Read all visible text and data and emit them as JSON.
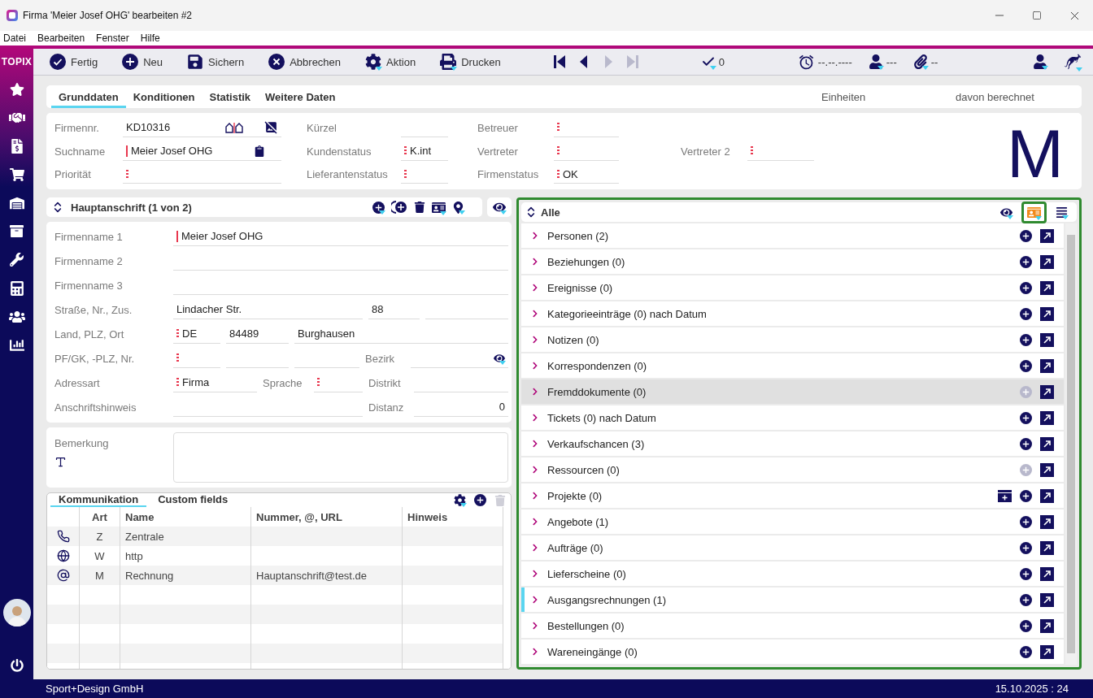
{
  "window": {
    "title": "Firma 'Meier Josef OHG' bearbeiten #2"
  },
  "menu": [
    "Datei",
    "Bearbeiten",
    "Fenster",
    "Hilfe"
  ],
  "sidebar": {
    "logo": "TOPIX"
  },
  "toolbar": {
    "buttons": [
      {
        "kind": "done",
        "label": "Fertig"
      },
      {
        "kind": "new",
        "label": "Neu"
      },
      {
        "kind": "save",
        "label": "Sichern"
      },
      {
        "kind": "cancel",
        "label": "Abbrechen"
      },
      {
        "kind": "action",
        "label": "Aktion"
      },
      {
        "kind": "print",
        "label": "Drucken"
      }
    ],
    "nav": [
      {
        "kind": "first",
        "disabled": false
      },
      {
        "kind": "prev",
        "disabled": false
      },
      {
        "kind": "next",
        "disabled": true
      },
      {
        "kind": "last",
        "disabled": true
      }
    ],
    "status": [
      {
        "kind": "check",
        "text": "0"
      },
      {
        "kind": "alarm",
        "text": "--.--.----"
      },
      {
        "kind": "person",
        "text": "---"
      },
      {
        "kind": "clip",
        "text": "--"
      }
    ]
  },
  "tabs": [
    {
      "label": "Grunddaten",
      "selected": true
    },
    {
      "label": "Konditionen",
      "selected": false
    },
    {
      "label": "Statistik",
      "selected": false
    },
    {
      "label": "Weitere Daten",
      "selected": false
    }
  ],
  "tab_columns": [
    "Einheiten",
    "davon berechnet"
  ],
  "header_fields": [
    [
      {
        "label": "Firmennr.",
        "value": "KD10316",
        "kind": "number",
        "required": false,
        "dotted": false
      },
      {
        "label": "Kürzel",
        "required": false,
        "dotted": false
      },
      {
        "label": "Betreuer",
        "required": false,
        "dotted": true
      }
    ],
    [
      {
        "label": "Suchname",
        "value": "Meier Josef OHG",
        "kind": "search",
        "required": true,
        "dotted": false
      },
      {
        "label": "Kundenstatus",
        "value": "K.int",
        "required": false,
        "dotted": true
      },
      {
        "label": "Vertreter",
        "required": false,
        "dotted": true
      },
      {
        "label": "Vertreter 2",
        "required": false,
        "dotted": true
      }
    ],
    [
      {
        "label": "Priorität",
        "required": false,
        "dotted": true
      },
      {
        "label": "Lieferantenstatus",
        "required": false,
        "dotted": true
      },
      {
        "label": "Firmenstatus",
        "value": "OK",
        "required": false,
        "dotted": true
      }
    ]
  ],
  "logo_letter": "M",
  "address": {
    "title": "Hauptanschrift (1 von 2)",
    "rows": [
      {
        "label": "Firmenname 1",
        "kind": "full",
        "items": [
          {
            "kind": "field",
            "value": "Meier Josef OHG",
            "required": true,
            "dotted": false
          }
        ]
      },
      {
        "label": "Firmenname 2",
        "kind": "full",
        "items": [
          {
            "kind": "field",
            "required": false,
            "dotted": false
          }
        ]
      },
      {
        "label": "Firmenname 3",
        "kind": "full",
        "items": [
          {
            "kind": "field",
            "required": false,
            "dotted": false
          }
        ]
      },
      {
        "label": "Straße, Nr., Zus.",
        "kind": "street",
        "items": [
          {
            "kind": "field",
            "value": "Lindacher Str.",
            "required": false,
            "dotted": false
          },
          {
            "kind": "field",
            "value": "88",
            "required": false,
            "dotted": false
          },
          {
            "kind": "field",
            "required": false,
            "dotted": false
          }
        ]
      },
      {
        "label": "Land, PLZ, Ort",
        "kind": "city",
        "items": [
          {
            "kind": "field",
            "value": "DE",
            "required": false,
            "dotted": true
          },
          {
            "kind": "field",
            "value": "84489",
            "required": false,
            "dotted": false
          },
          {
            "kind": "field",
            "value": "Burghausen",
            "required": false,
            "dotted": false
          }
        ]
      },
      {
        "label": "PF/GK, -PLZ, Nr.",
        "kind": "pobox",
        "items": [
          {
            "kind": "field",
            "required": false,
            "dotted": true
          },
          {
            "kind": "field",
            "required": false,
            "dotted": false
          },
          {
            "kind": "field",
            "required": false,
            "dotted": false
          },
          {
            "kind": "label",
            "text": "Bezirk"
          },
          {
            "kind": "lookup"
          }
        ]
      },
      {
        "label": "Adressart",
        "kind": "type",
        "items": [
          {
            "kind": "field",
            "value": "Firma",
            "required": false,
            "dotted": true
          },
          {
            "kind": "label",
            "text": "Sprache"
          },
          {
            "kind": "field",
            "required": false,
            "dotted": true
          },
          {
            "kind": "label",
            "text": "Distrikt"
          },
          {
            "kind": "field",
            "required": false,
            "dotted": false
          }
        ]
      },
      {
        "label": "Anschriftshinweis",
        "kind": "hint",
        "items": [
          {
            "kind": "field",
            "required": false,
            "dotted": false
          },
          {
            "kind": "label",
            "text": "Distanz"
          },
          {
            "kind": "number",
            "value": "0"
          }
        ]
      }
    ]
  },
  "remark": {
    "label": "Bemerkung"
  },
  "communication": {
    "tabs": [
      {
        "label": "Kommunikation",
        "selected": true
      },
      {
        "label": "Custom fields",
        "selected": false
      }
    ],
    "tools": [
      {
        "kind": "settings",
        "disabled": false
      },
      {
        "kind": "add",
        "disabled": false
      },
      {
        "kind": "delete",
        "disabled": true
      }
    ],
    "columns": [
      "Art",
      "Name",
      "Nummer, @, URL",
      "Hinweis"
    ],
    "rows": [
      {
        "kind": "phone",
        "art": "Z",
        "name": "Zentrale"
      },
      {
        "kind": "web",
        "art": "W",
        "name": "http"
      },
      {
        "kind": "email",
        "art": "M",
        "name": "Rechnung",
        "number": "Hauptanschrift@test.de"
      }
    ]
  },
  "related": {
    "title": "Alle",
    "tools": [
      {
        "kind": "view",
        "selected": false
      },
      {
        "kind": "card",
        "selected": true
      },
      {
        "kind": "list",
        "selected": false
      }
    ],
    "items": [
      {
        "label": "Personen (2)",
        "highlighted": false,
        "marked": false,
        "add_disabled": false,
        "extra_action": false
      },
      {
        "label": "Beziehungen (0)",
        "highlighted": false,
        "marked": false,
        "add_disabled": false,
        "extra_action": false
      },
      {
        "label": "Ereignisse (0)",
        "highlighted": false,
        "marked": false,
        "add_disabled": false,
        "extra_action": false
      },
      {
        "label": "Kategorieeinträge (0) nach Datum",
        "highlighted": false,
        "marked": false,
        "add_disabled": false,
        "extra_action": false
      },
      {
        "label": "Notizen (0)",
        "highlighted": false,
        "marked": false,
        "add_disabled": false,
        "extra_action": false
      },
      {
        "label": "Korrespondenzen (0)",
        "highlighted": false,
        "marked": false,
        "add_disabled": false,
        "extra_action": false
      },
      {
        "label": "Fremddokumente (0)",
        "highlighted": true,
        "marked": false,
        "add_disabled": true,
        "extra_action": false
      },
      {
        "label": "Tickets (0) nach Datum",
        "highlighted": false,
        "marked": false,
        "add_disabled": false,
        "extra_action": false
      },
      {
        "label": "Verkaufschancen (3)",
        "highlighted": false,
        "marked": false,
        "add_disabled": false,
        "extra_action": false
      },
      {
        "label": "Ressourcen (0)",
        "highlighted": false,
        "marked": false,
        "add_disabled": true,
        "extra_action": false
      },
      {
        "label": "Projekte (0)",
        "highlighted": false,
        "marked": false,
        "add_disabled": false,
        "extra_action": true
      },
      {
        "label": "Angebote (1)",
        "highlighted": false,
        "marked": false,
        "add_disabled": false,
        "extra_action": false
      },
      {
        "label": "Aufträge (0)",
        "highlighted": false,
        "marked": false,
        "add_disabled": false,
        "extra_action": false
      },
      {
        "label": "Lieferscheine (0)",
        "highlighted": false,
        "marked": false,
        "add_disabled": false,
        "extra_action": false
      },
      {
        "label": "Ausgangsrechnungen (1)",
        "highlighted": false,
        "marked": true,
        "add_disabled": false,
        "extra_action": false
      },
      {
        "label": "Bestellungen (0)",
        "highlighted": false,
        "marked": false,
        "add_disabled": false,
        "extra_action": false
      },
      {
        "label": "Wareneingänge (0)",
        "highlighted": false,
        "marked": false,
        "add_disabled": false,
        "extra_action": false
      }
    ]
  },
  "status_bar": {
    "company": "Sport+Design GmbH",
    "date": "15.10.2025 : 24"
  }
}
